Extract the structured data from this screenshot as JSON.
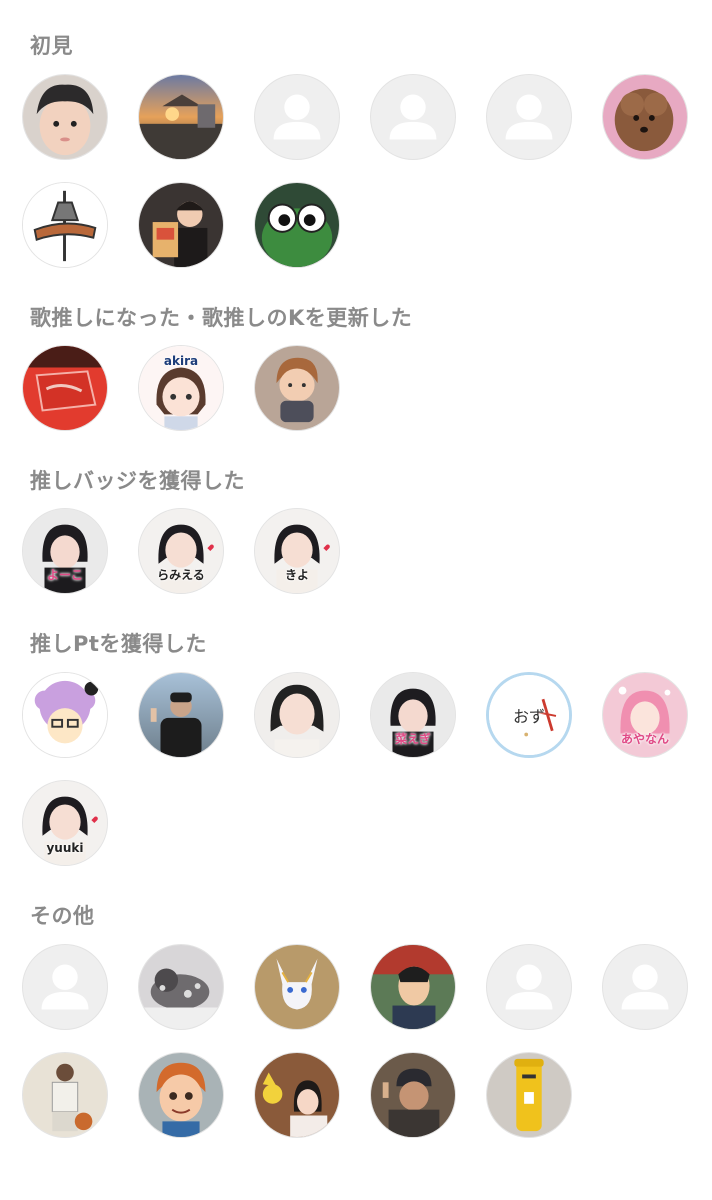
{
  "sections": [
    {
      "title": "初見"
    },
    {
      "title": "歌推しになった・歌推しのKを更新した"
    },
    {
      "title": "推しバッジを獲得した"
    },
    {
      "title": "推しPtを獲得した"
    },
    {
      "title": "その他"
    }
  ],
  "avatar_labels": {
    "akira": "akira",
    "yoko": "よーこ",
    "ramieru": "らみえる",
    "kiyo": "きよ",
    "ozu": "おず",
    "ayanan": "あやなん",
    "yuuki": "yuuki",
    "kaede": "菜えぎ"
  },
  "placeholder_icon": "default-user-icon",
  "colors": {
    "section_title": "#8a8a8a",
    "placeholder_bg": "#efefef",
    "placeholder_fg": "#ffffff"
  }
}
